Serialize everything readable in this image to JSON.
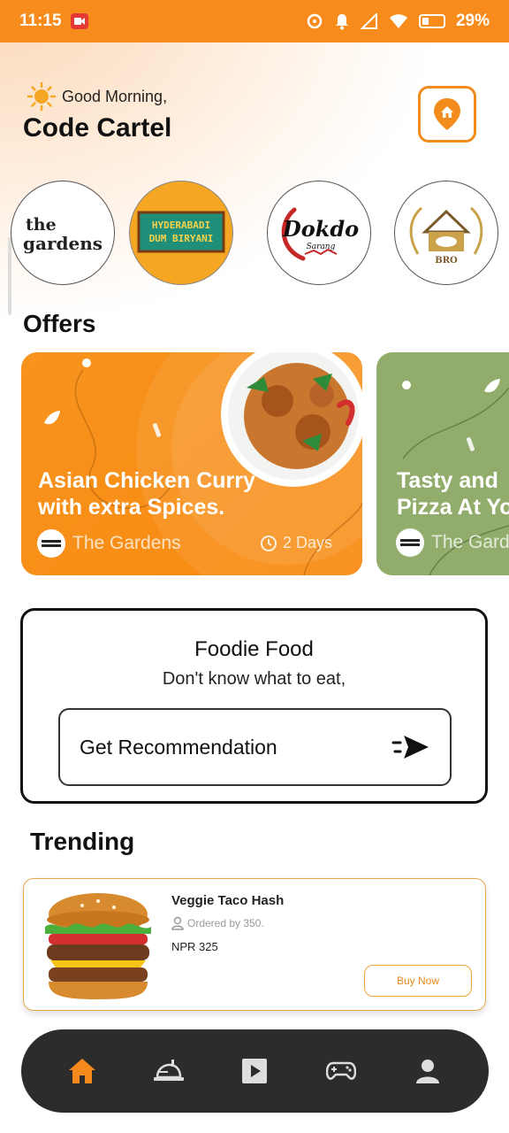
{
  "status_bar": {
    "time": "11:15",
    "battery": "29%"
  },
  "header": {
    "greeting": "Good Morning,",
    "user_name": "Code Cartel"
  },
  "restaurants": [
    {
      "name": "the gardens"
    },
    {
      "name": "HYDERABADI DUM BIRYANI"
    },
    {
      "name": "Dokdo Sarang"
    },
    {
      "name": "BRO"
    }
  ],
  "offers": {
    "title": "Offers",
    "cards": [
      {
        "title_line1": "Asian Chicken Curry",
        "title_line2": "with extra  Spices.",
        "restaurant": "The Gardens",
        "duration": "2 Days"
      },
      {
        "title_line1": "Tasty and",
        "title_line2": "Pizza At Yo",
        "restaurant": "The Gard"
      }
    ]
  },
  "foodie": {
    "title": "Foodie Food",
    "subtitle": "Don't know what to eat,",
    "button_label": "Get Recommendation"
  },
  "trending": {
    "title": "Trending",
    "items": [
      {
        "name": "Veggie Taco Hash",
        "orders": "Ordered by 350.",
        "price": "NPR 325",
        "button": "Buy Now"
      }
    ]
  },
  "colors": {
    "accent": "#f78c1c",
    "offer_orange": "#f7931e",
    "offer_green": "#92ad6b",
    "nav_bg": "#2c2c2c"
  },
  "bottom_nav": [
    "home-icon",
    "food-tray-icon",
    "play-icon",
    "gamepad-icon",
    "profile-icon"
  ]
}
